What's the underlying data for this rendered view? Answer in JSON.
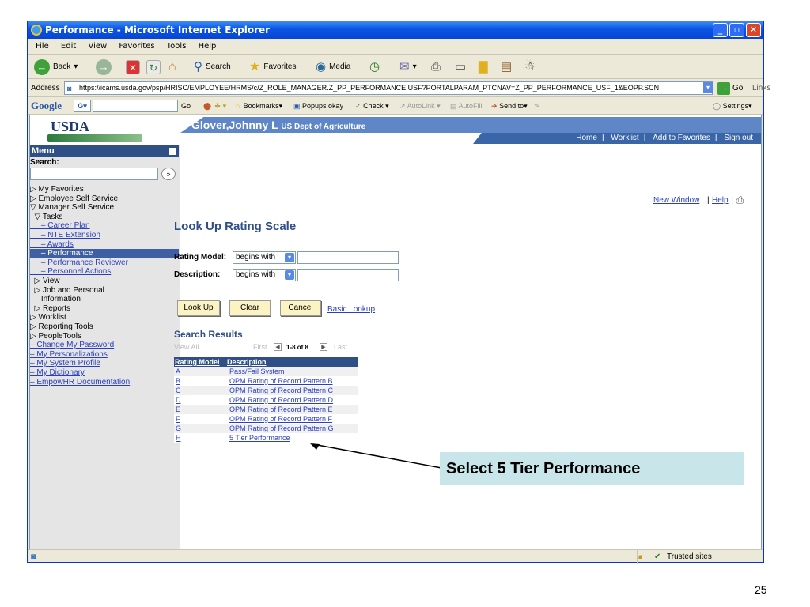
{
  "window": {
    "title": "Performance - Microsoft Internet Explorer",
    "menu": [
      "File",
      "Edit",
      "View",
      "Favorites",
      "Tools",
      "Help"
    ],
    "toolbar": {
      "back": "Back",
      "search": "Search",
      "favorites": "Favorites",
      "media": "Media"
    },
    "address": {
      "label": "Address",
      "url": "https://icams.usda.gov/psp/HRISC/EMPLOYEE/HRMS/c/Z_ROLE_MANAGER.Z_PP_PERFORMANCE.USF?PORTALPARAM_PTCNAV=Z_PP_PERFORMANCE_USF_1&EOPP.SCN",
      "go": "Go",
      "links": "Links"
    },
    "google": {
      "brand": "Google",
      "go": "Go",
      "bookmarks": "Bookmarks",
      "popups": "Popups okay",
      "check": "Check",
      "autolink": "AutoLink",
      "autofill": "AutoFill",
      "sendto": "Send to",
      "settings": "Settings"
    },
    "status": {
      "zone": "Trusted sites"
    }
  },
  "page": {
    "logo": "USDA",
    "user": "Glover,Johnny L",
    "agency": "US Dept of Agriculture",
    "nav": [
      "Home",
      "Worklist",
      "Add to Favorites",
      "Sign out"
    ],
    "top_links": {
      "new_window": "New Window",
      "help": "Help"
    },
    "menu_title": "Menu",
    "search_label": "Search:",
    "menu_items": [
      {
        "text": "▷ My Favorites",
        "link": false
      },
      {
        "text": "▷ Employee Self Service",
        "link": false
      },
      {
        "text": "▽ Manager Self Service",
        "link": false
      },
      {
        "text": "  ▽ Tasks",
        "link": false
      },
      {
        "text": "     – Career Plan",
        "link": true
      },
      {
        "text": "     – NTE Extension",
        "link": true
      },
      {
        "text": "     – Awards",
        "link": true
      },
      {
        "text": "     – Performance",
        "link": true,
        "selected": true
      },
      {
        "text": "     – Performance Reviewer",
        "link": true
      },
      {
        "text": "     – Personnel Actions",
        "link": true
      },
      {
        "text": "  ▷ View",
        "link": false
      },
      {
        "text": "  ▷ Job and Personal",
        "link": false
      },
      {
        "text": "     Information",
        "link": false
      },
      {
        "text": "  ▷ Reports",
        "link": false
      },
      {
        "text": "▷ Worklist",
        "link": false
      },
      {
        "text": "▷ Reporting Tools",
        "link": false
      },
      {
        "text": "▷ PeopleTools",
        "link": false
      },
      {
        "text": "– Change My Password",
        "link": true
      },
      {
        "text": "– My Personalizations",
        "link": true
      },
      {
        "text": "– My System Profile",
        "link": true
      },
      {
        "text": "– My Dictionary",
        "link": true
      },
      {
        "text": "– EmpowHR Documentation",
        "link": true
      }
    ],
    "heading": "Look Up Rating Scale",
    "fields": {
      "rating_model_label": "Rating Model:",
      "rating_model_op": "begins with",
      "description_label": "Description:",
      "description_op": "begins with"
    },
    "buttons": {
      "lookup": "Look Up",
      "clear": "Clear",
      "cancel": "Cancel",
      "basic": "Basic Lookup"
    },
    "results": {
      "title": "Search Results",
      "view_all": "View All",
      "first": "First",
      "range": "1-8 of 8",
      "last": "Last",
      "columns": [
        "Rating Model",
        "Description"
      ],
      "rows": [
        {
          "model": "A",
          "desc": "Pass/Fail System"
        },
        {
          "model": "B",
          "desc": "OPM Rating of Record Pattern B"
        },
        {
          "model": "C",
          "desc": "OPM Rating of Record Pattern C"
        },
        {
          "model": "D",
          "desc": "OPM Rating of Record Pattern D"
        },
        {
          "model": "E",
          "desc": "OPM Rating of Record Pattern E"
        },
        {
          "model": "F",
          "desc": "OPM Rating of Record Pattern F"
        },
        {
          "model": "G",
          "desc": "OPM Rating of Record Pattern G"
        },
        {
          "model": "H",
          "desc": "5 Tier Performance"
        }
      ]
    }
  },
  "annotation": {
    "callout": "Select 5 Tier Performance"
  },
  "slide_number": "25"
}
